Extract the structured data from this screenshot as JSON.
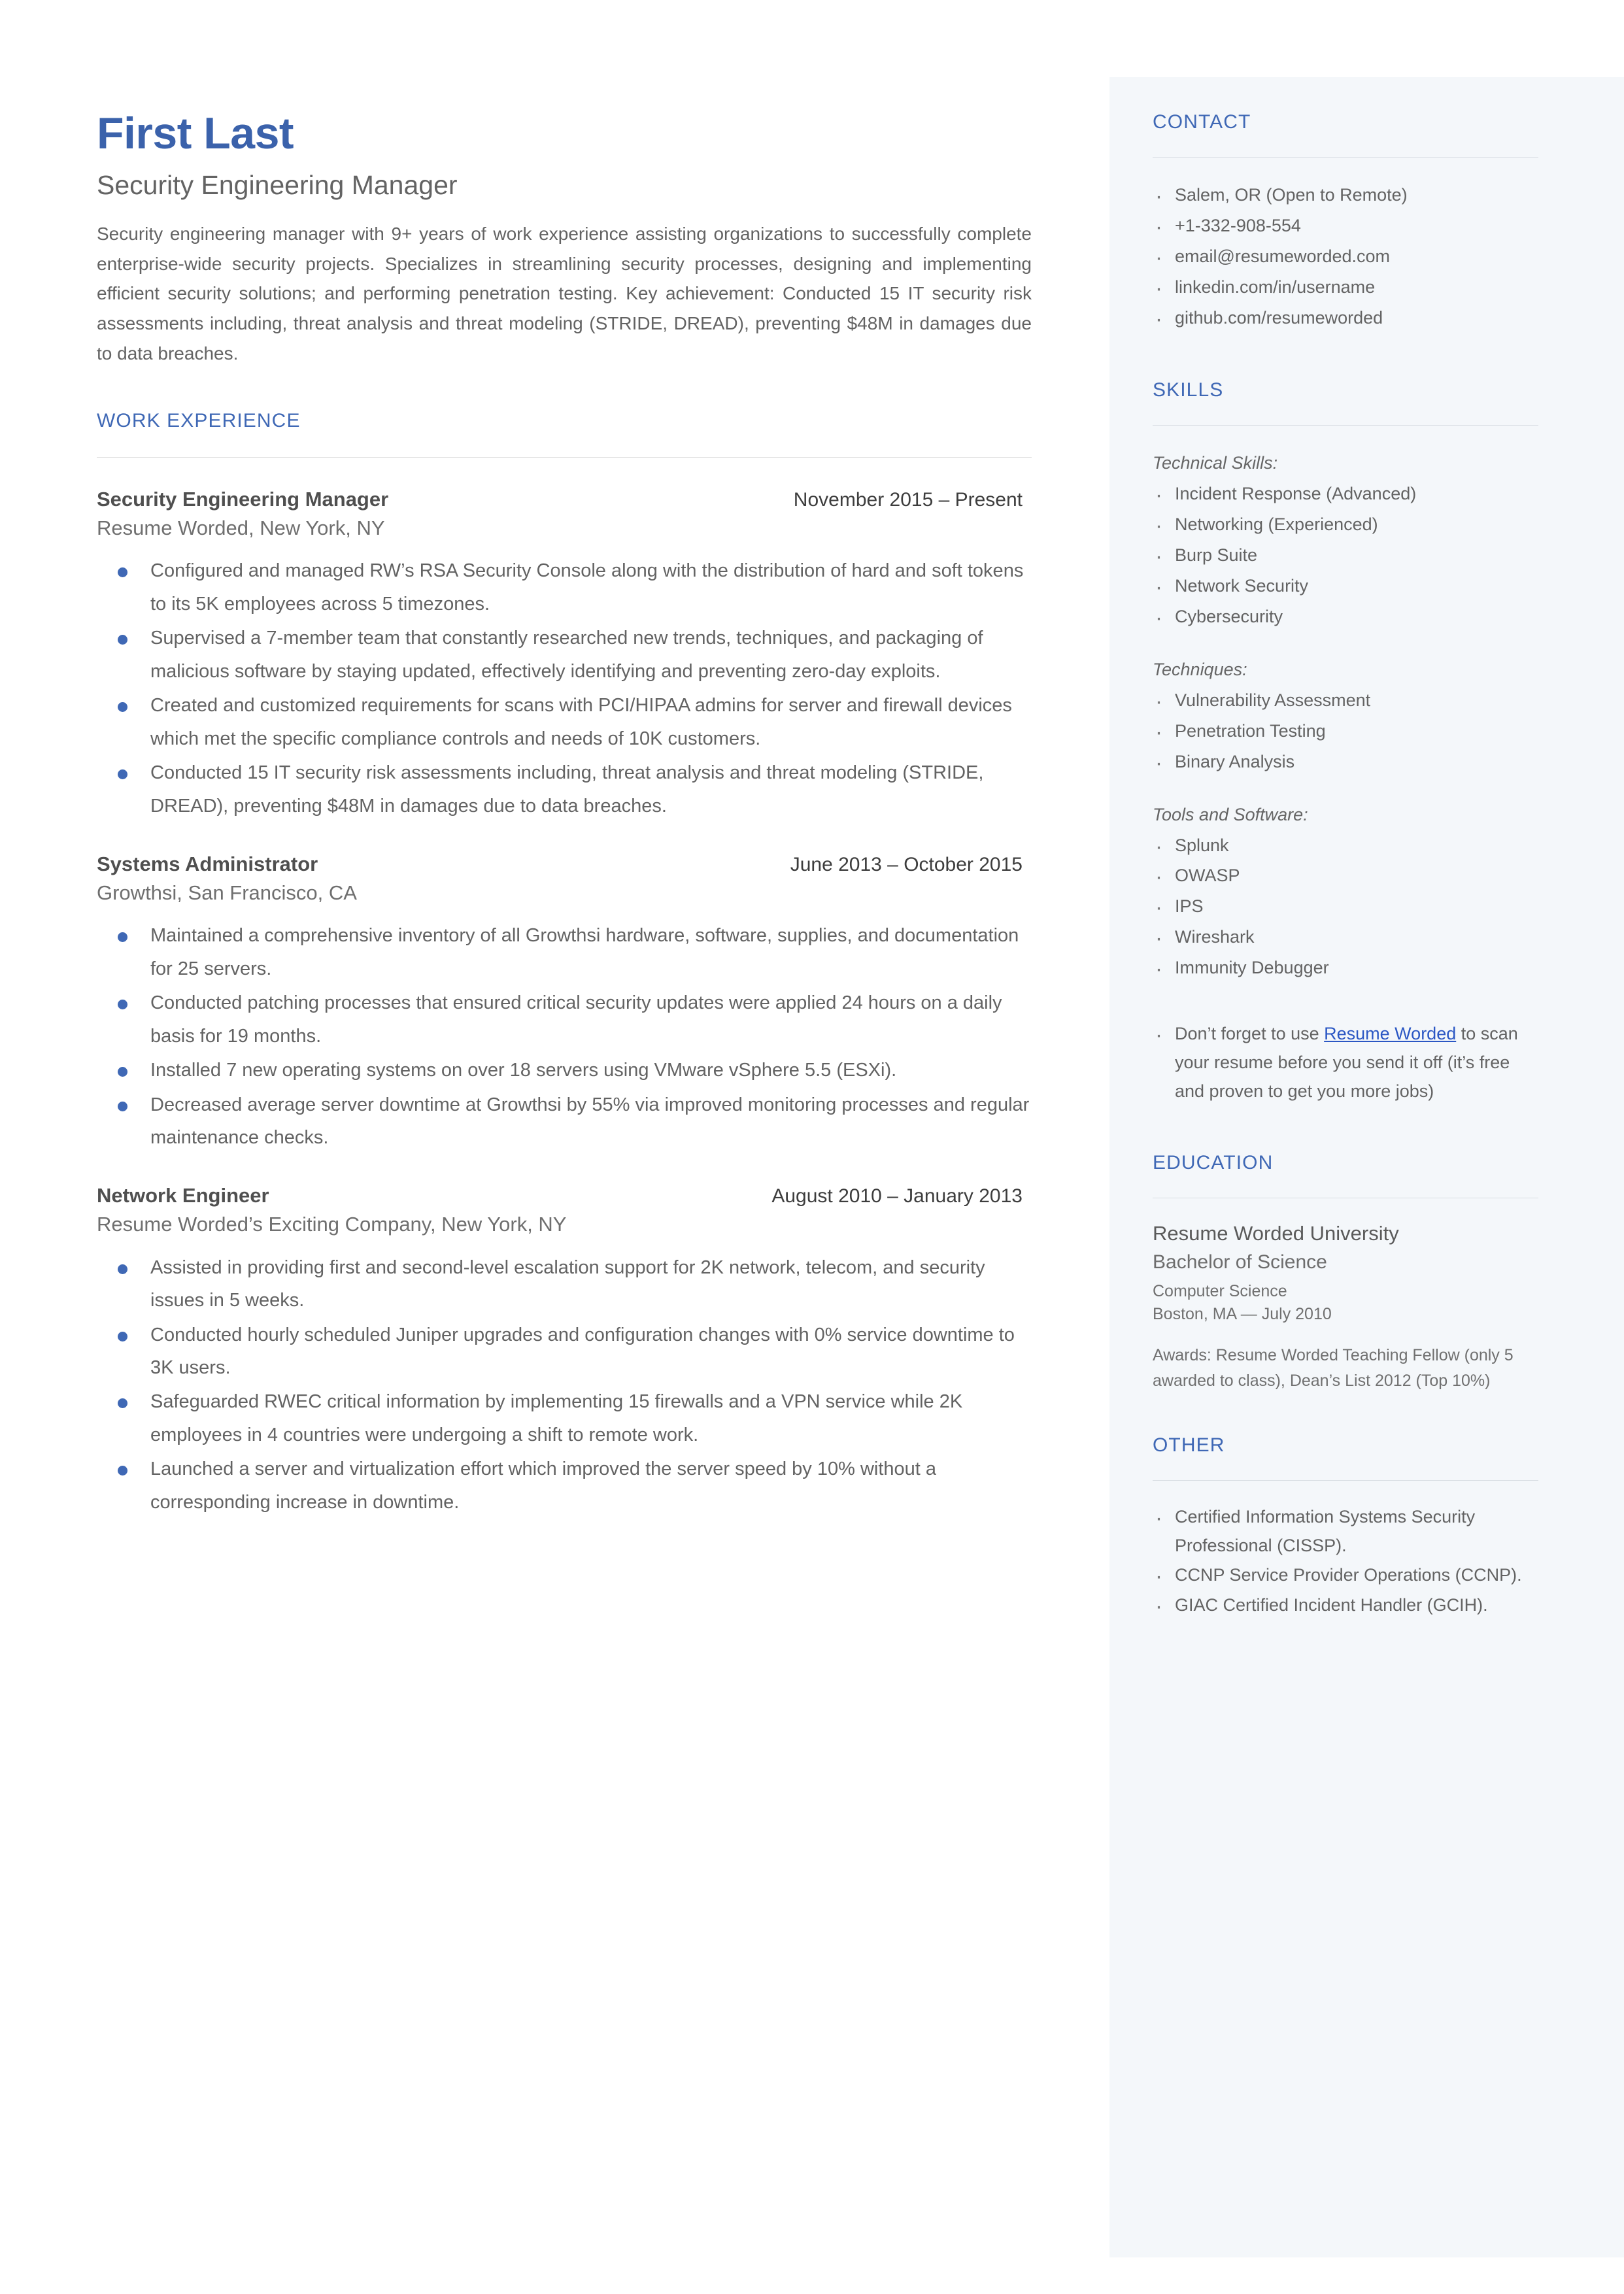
{
  "theme": {
    "accent": "#3f68b5",
    "name_color": "#3b62ab",
    "body_text": "#636363",
    "sidebar_bg": "#f4f7fa",
    "link_color": "#2b57c4",
    "rule_color": "#dcdcdc"
  },
  "header": {
    "name": "First Last",
    "headline": "Security Engineering Manager",
    "summary": "Security engineering manager with 9+ years of work experience assisting organizations to successfully complete enterprise-wide security projects. Specializes in streamlining security processes, designing and implementing efficient security solutions; and performing penetration testing. Key achievement: Conducted 15 IT security risk assessments including, threat analysis and threat modeling (STRIDE, DREAD), preventing $48M in damages due to data breaches."
  },
  "work_experience": {
    "section_title": "WORK EXPERIENCE",
    "jobs": [
      {
        "title": "Security Engineering Manager",
        "dates": "November 2015 – Present",
        "company": "Resume Worded, New York, NY",
        "bullets": [
          "Configured and managed RW’s RSA Security Console along with the distribution of hard and soft tokens to its 5K employees across 5 timezones.",
          "Supervised a 7-member team that constantly researched new trends, techniques, and packaging of malicious software by staying updated, effectively identifying and preventing zero-day exploits.",
          "Created and customized requirements for scans with PCI/HIPAA admins for server and firewall devices which met the specific compliance controls and needs of 10K customers.",
          "Conducted 15 IT security risk assessments including, threat analysis and threat modeling (STRIDE, DREAD), preventing $48M in damages due to data breaches."
        ]
      },
      {
        "title": "Systems Administrator",
        "dates": "June 2013 – October 2015",
        "company": "Growthsi, San Francisco, CA",
        "bullets": [
          "Maintained a comprehensive inventory of all Growthsi hardware, software, supplies, and documentation for 25 servers.",
          "Conducted patching processes that ensured critical security updates were applied 24 hours on a daily basis for 19 months.",
          "Installed 7 new operating systems on over 18 servers using VMware vSphere 5.5 (ESXi).",
          "Decreased average server downtime at Growthsi by 55% via improved monitoring processes and regular maintenance checks."
        ]
      },
      {
        "title": "Network Engineer",
        "dates": "August 2010 – January 2013",
        "company": "Resume Worded’s Exciting Company, New York, NY",
        "bullets": [
          "Assisted in providing first and second-level escalation support for 2K network, telecom, and security issues in 5 weeks.",
          "Conducted hourly scheduled Juniper upgrades and configuration changes with 0% service downtime to 3K users.",
          "Safeguarded RWEC critical information by implementing 15 firewalls and a VPN service while 2K employees in 4 countries were undergoing a shift to remote work.",
          "Launched a server and virtualization effort which improved the server speed by 10% without a corresponding increase in downtime."
        ]
      }
    ]
  },
  "contact": {
    "section_title": "CONTACT",
    "items": [
      "Salem, OR (Open to Remote)",
      "+1-332-908-554",
      "email@resumeworded.com",
      "linkedin.com/in/username",
      "github.com/resumeworded"
    ]
  },
  "skills": {
    "section_title": "SKILLS",
    "groups": [
      {
        "label": "Technical Skills:",
        "items": [
          "Incident Response (Advanced)",
          "Networking (Experienced)",
          "Burp Suite",
          "Network Security",
          "Cybersecurity"
        ]
      },
      {
        "label": "Techniques:",
        "items": [
          "Vulnerability Assessment",
          "Penetration Testing",
          "Binary Analysis"
        ]
      },
      {
        "label": "Tools and Software:",
        "items": [
          "Splunk",
          "OWASP",
          "IPS",
          "Wireshark",
          "Immunity Debugger"
        ]
      }
    ],
    "promo": {
      "before": "Don’t forget to use ",
      "link_text": "Resume Worded",
      "after": " to scan your resume before you send it off (it’s free and proven to get you more jobs)"
    }
  },
  "education": {
    "section_title": "EDUCATION",
    "school": "Resume Worded University",
    "degree": "Bachelor of Science",
    "field": "Computer Science",
    "location_date": "Boston, MA — July 2010",
    "awards": "Awards: Resume Worded Teaching Fellow (only 5 awarded to class), Dean’s List 2012 (Top 10%)"
  },
  "other": {
    "section_title": "OTHER",
    "items": [
      "Certified Information Systems Security Professional (CISSP).",
      "CCNP Service Provider Operations (CCNP).",
      "GIAC Certified Incident Handler (GCIH)."
    ]
  }
}
